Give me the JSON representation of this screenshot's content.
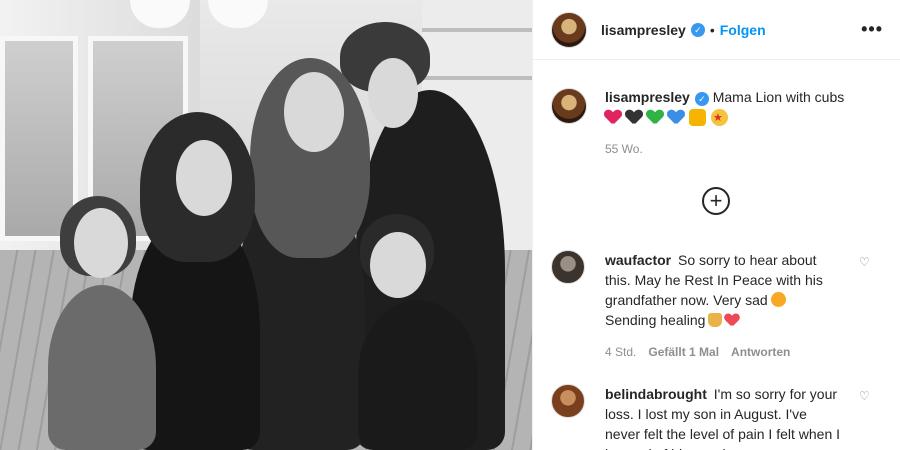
{
  "post": {
    "username": "lisampresley",
    "follow_label": "Folgen",
    "more_label": "•••"
  },
  "caption": {
    "username": "lisampresley",
    "text": "Mama Lion with cubs",
    "emojis": [
      {
        "name": "red-heart-icon",
        "color": "#e0245e"
      },
      {
        "name": "black-heart-icon",
        "color": "#333333"
      },
      {
        "name": "green-heart-icon",
        "color": "#2fb344"
      },
      {
        "name": "blue-heart-icon",
        "color": "#3b8ee8"
      },
      {
        "name": "lion-face-icon",
        "color": "#f4b400"
      },
      {
        "name": "star-struck-icon",
        "color": "#f7c23c"
      }
    ],
    "time": "55 Wo."
  },
  "load_more_icon": "plus-circle-icon",
  "comments": [
    {
      "username": "waufactor",
      "text": "So sorry to hear about this. May he Rest In Peace with his grandfather now. Very sad",
      "text2": "Sending healing",
      "time": "4 Std.",
      "likes": "Gefällt 1 Mal",
      "reply": "Antworten"
    },
    {
      "username": "belindabrought",
      "text": "I'm so sorry for your loss. I lost my son in August. I've never felt the level of pain I felt when I learned of his passing"
    }
  ],
  "colors": {
    "link": "#0095f6",
    "verified": "#3897f0",
    "muted": "#8e8e8e"
  }
}
